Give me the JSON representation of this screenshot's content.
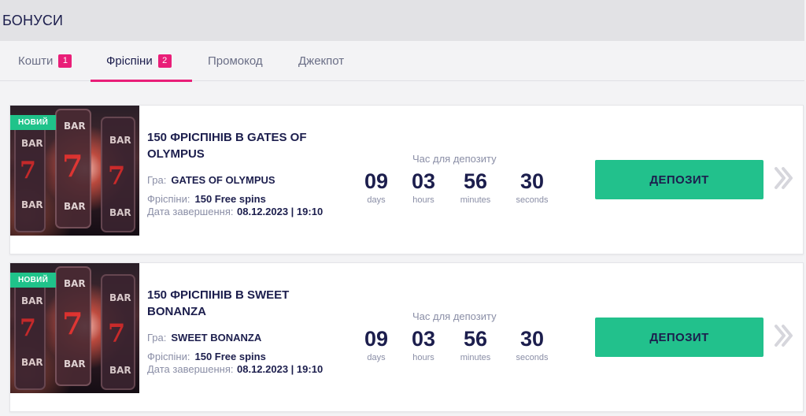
{
  "page": {
    "title": "БОНУСИ"
  },
  "tabs": [
    {
      "label": "Кошти",
      "badge": "1",
      "active": false
    },
    {
      "label": "Фріспіни",
      "badge": "2",
      "active": true
    },
    {
      "label": "Промокод",
      "badge": "",
      "active": false
    },
    {
      "label": "Джекпот",
      "badge": "",
      "active": false
    }
  ],
  "colors": {
    "accent": "#e91e78",
    "button": "#22c18c",
    "tag": "#1fc38a",
    "text": "#1c1e4d"
  },
  "bonuses": [
    {
      "tag": "НОВИЙ",
      "title": "150 ФРІСПІНІВ В GATES OF OLYMPUS",
      "game_label": "Гра:",
      "game": "GATES OF OLYMPUS",
      "spins_label": "Фріспіни:",
      "spins": "150 Free spins",
      "end_label": "Дата завершення:",
      "end_value": "08.12.2023 | 19:10",
      "timer_label": "Час для депозиту",
      "timer": [
        {
          "value": "09",
          "unit": "days"
        },
        {
          "value": "03",
          "unit": "hours"
        },
        {
          "value": "56",
          "unit": "minutes"
        },
        {
          "value": "30",
          "unit": "seconds"
        }
      ],
      "button": "ДЕПОЗИТ",
      "chevron_icon": "double-chevron-right-icon"
    },
    {
      "tag": "НОВИЙ",
      "title": "150 ФРІСПІНІВ В SWEET BONANZA",
      "game_label": "Гра:",
      "game": "SWEET BONANZA",
      "spins_label": "Фріспіни:",
      "spins": "150 Free spins",
      "end_label": "Дата завершення:",
      "end_value": "08.12.2023 | 19:10",
      "timer_label": "Час для депозиту",
      "timer": [
        {
          "value": "09",
          "unit": "days"
        },
        {
          "value": "03",
          "unit": "hours"
        },
        {
          "value": "56",
          "unit": "minutes"
        },
        {
          "value": "30",
          "unit": "seconds"
        }
      ],
      "button": "ДЕПОЗИТ",
      "chevron_icon": "double-chevron-right-icon"
    }
  ]
}
